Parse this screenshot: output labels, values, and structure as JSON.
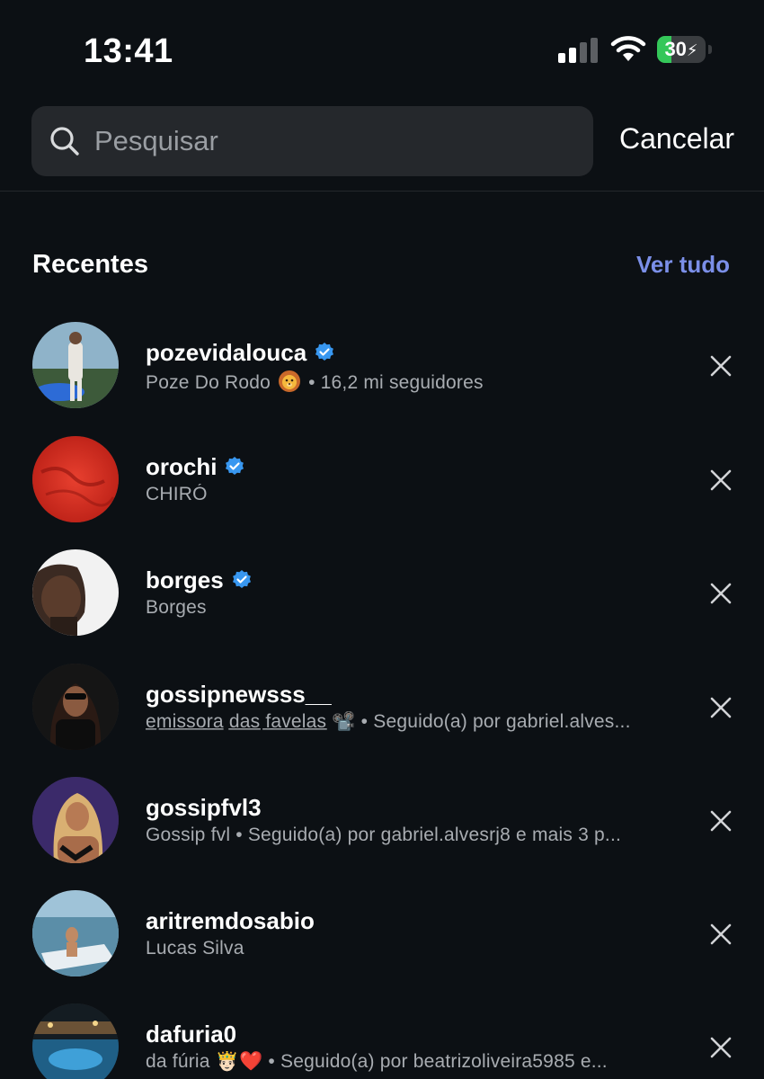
{
  "status_bar": {
    "time": "13:41",
    "battery_level": "30",
    "battery_fill_fraction": 0.3,
    "battery_color": "#34c759",
    "icons": [
      "cellular-signal-icon",
      "wifi-icon",
      "battery-charging-icon"
    ]
  },
  "search": {
    "placeholder": "Pesquisar",
    "value": "",
    "cancel_label": "Cancelar"
  },
  "recent": {
    "title": "Recentes",
    "see_all_label": "Ver tudo",
    "accent_color": "#7b8fe8",
    "items": [
      {
        "username": "pozevidalouca",
        "verified": true,
        "subtitle_pre": "Poze Do Rodo",
        "subtitle_emoji": "lion-face",
        "subtitle_post": " • 16,2 mi seguidores"
      },
      {
        "username": "orochi",
        "verified": true,
        "subtitle": "CHIRÓ"
      },
      {
        "username": "borges",
        "verified": true,
        "subtitle": "Borges"
      },
      {
        "username": "gossipnewsss__",
        "verified": false,
        "subtitle": "e̲m̲i̲s̲s̲o̲r̲a̲ d̲a̲s̲ f̲a̲v̲e̲l̲a̲s̲ 📽️ • Seguido(a) por gabriel.alves..."
      },
      {
        "username": "gossipfvl3",
        "verified": false,
        "subtitle": "Gossip fvl • Seguido(a) por gabriel.alvesrj8 e mais 3 p..."
      },
      {
        "username": "aritremdosabio",
        "verified": false,
        "subtitle": "Lucas Silva"
      },
      {
        "username": "dafuria0",
        "verified": false,
        "subtitle": "da fúria 🤴🏻❤️ • Seguido(a) por beatrizoliveira5985 e..."
      }
    ]
  },
  "verified_color": "#3897f0"
}
